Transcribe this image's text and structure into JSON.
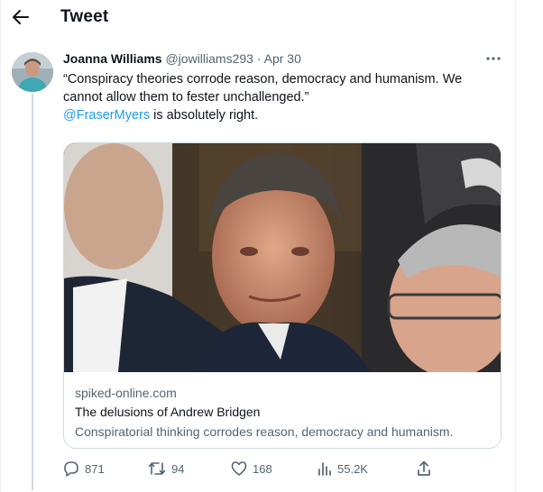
{
  "header": {
    "title": "Tweet"
  },
  "tweet": {
    "author_name": "Joanna Williams",
    "author_handle": "@jowilliams293",
    "separator": "·",
    "date": "Apr 30",
    "text_line1": "“Conspiracy theories corrode reason, democracy and humanism. We",
    "text_line2": "cannot allow them to fester unchallenged.”",
    "mention": "@FraserMyers",
    "text_line3_rest": " is absolutely right."
  },
  "card": {
    "domain": "spiked-online.com",
    "title": "The delusions of Andrew Bridgen",
    "description": "Conspiratorial thinking corrodes reason, democracy and humanism."
  },
  "actions": {
    "replies": "871",
    "retweets": "94",
    "likes": "168",
    "views": "55.2K"
  },
  "colors": {
    "accent": "#1d9bf0",
    "secondary_text": "#536471",
    "border": "#cfd9de"
  },
  "icons": [
    "back-arrow-icon",
    "more-icon",
    "reply-icon",
    "retweet-icon",
    "like-icon",
    "views-icon",
    "share-icon"
  ]
}
